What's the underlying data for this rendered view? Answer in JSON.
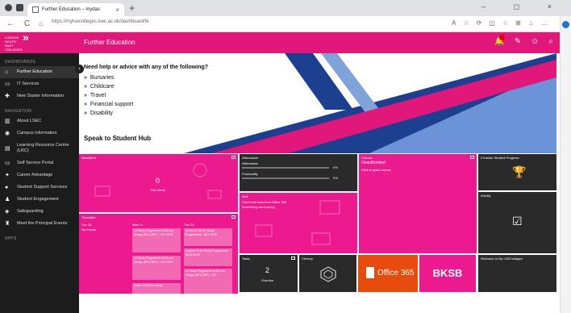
{
  "browser": {
    "tab_title": "Further Education – mydas",
    "tab_close": "×",
    "new_tab": "+",
    "url": "https://mylsecolleges.lsec.ac.uk/dashboard/fe",
    "back": "←",
    "refresh": "C",
    "window_controls": "– ◻ ×"
  },
  "header": {
    "logo_text": "LONDON SOUTH EAST COLLEGES",
    "title": "Further Education",
    "icons": [
      "bell-icon",
      "link-icon",
      "user-icon",
      "search-icon"
    ]
  },
  "sidebar": {
    "sections": {
      "dashboards": "DASHBOARDS",
      "navigation": "NAVIGATION",
      "apps": "APPS"
    },
    "dashboards": [
      {
        "label": "Further Education",
        "icon": "home-icon"
      },
      {
        "label": "IT Services",
        "icon": "monitor-icon"
      },
      {
        "label": "New Starter Information",
        "icon": "handshake-icon"
      }
    ],
    "navigation": [
      {
        "label": "About LSEC",
        "icon": "building-icon"
      },
      {
        "label": "Campus Information",
        "icon": "map-pin-icon"
      },
      {
        "label": "Learning Resource Centre (LRC)",
        "icon": "book-icon"
      },
      {
        "label": "Self Service Portal",
        "icon": "laptop-icon"
      },
      {
        "label": "Career Advantage",
        "icon": "plus-icon"
      },
      {
        "label": "Student Support Services",
        "icon": "support-icon"
      },
      {
        "label": "Student Engagement",
        "icon": "users-icon"
      },
      {
        "label": "Safeguarding",
        "icon": "shield-icon"
      },
      {
        "label": "Meet the Principal Events",
        "icon": "person-icon"
      }
    ]
  },
  "banner": {
    "question": "Need help or advice with any of the following?",
    "items": [
      "Bursaries",
      "Childcare",
      "Travel",
      "Financial support",
      "Disability"
    ],
    "cta": "Speak to Student Hub"
  },
  "tiles": {
    "newsfeed": {
      "title": "Newsfeed",
      "count": "0",
      "caption": "This Week"
    },
    "attendance": {
      "title": "Attendance",
      "row1": "Attendance",
      "row2": "Punctuality",
      "pct1": "0%",
      "pct2": "0%"
    },
    "canvas": {
      "title": "Canvas",
      "status": "Unauthorised",
      "action": "Click to grant access"
    },
    "etracker": {
      "title": "eTracker Student Progress"
    },
    "mail": {
      "title": "Mail",
      "msg1": "Can't load data from Office 365",
      "msg2": "Something went wrong"
    },
    "ebuddy": {
      "title": "eNotify"
    },
    "timetable": {
      "title": "Timetable",
      "day_col": "Tue 10",
      "no_events": "No events",
      "col2": "Wed 11",
      "col3": "Thu 12",
      "events": [
        "L2 Study Programme in Art and Design (SPL1ART) - 107 09:30",
        "Maths GCSE for Study Programmes - B01 09:30",
        "L2 Study Programme in Art and Design (SPL1ART) - 107 13:30",
        "English FS for Study Programmes - B013 09:30",
        "Maths GCSE for Study",
        "L2 Study Programme in Art and Design (SPL1ART) - 107"
      ]
    },
    "tasks": {
      "title": "Tasks",
      "count": "2",
      "caption": "Overdue"
    },
    "century": {
      "title": "Century"
    },
    "office": {
      "label": "Office 365"
    },
    "bksb": {
      "label": "BKSB"
    },
    "welcome": {
      "title": "Welcome to My LSECollages"
    }
  },
  "colors": {
    "brand_pink": "#e1187a",
    "tile_pink": "#ec1a8e",
    "sidebar": "#1c1c1c",
    "banner_blue": "#1d3f8f",
    "office": "#e74c0c"
  }
}
